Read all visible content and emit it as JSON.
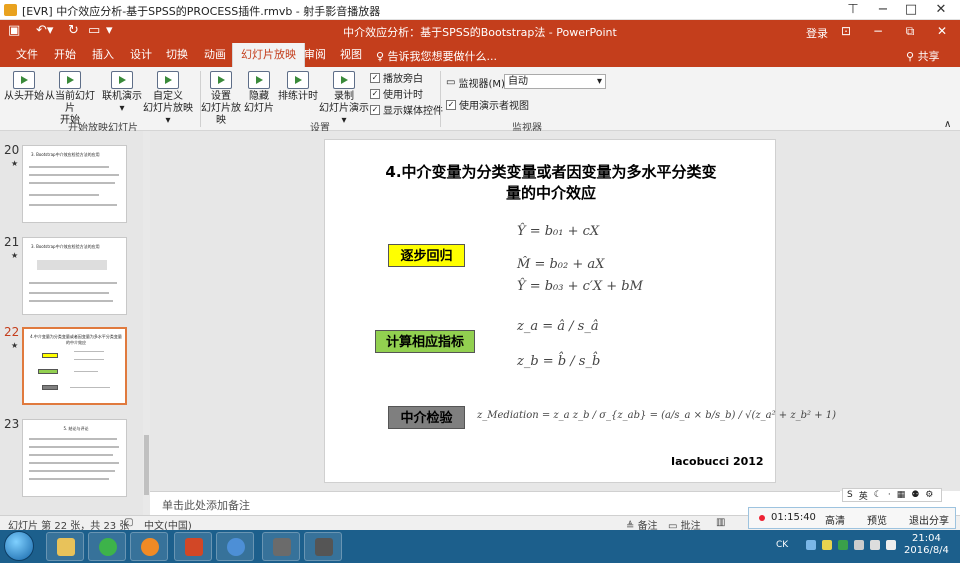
{
  "player": {
    "title": "[EVR] 中介效应分析-基于SPSS的PROCESS插件.rmvb - 射手影音播放器",
    "controls": {
      "pin": "⊤",
      "minimize": "−",
      "maximize": "□",
      "close": "✕"
    }
  },
  "ppt": {
    "window_title": "中介效应分析：基于SPSS的Bootstrap法 - PowerPoint",
    "login": "登录",
    "tabs": [
      "文件",
      "开始",
      "插入",
      "设计",
      "切换",
      "动画",
      "幻灯片放映",
      "审阅",
      "视图"
    ],
    "active_tab": "幻灯片放映",
    "tell_me": "♀ 告诉我您想要做什么...",
    "share": "共享"
  },
  "ribbon": {
    "start_group": {
      "label": "开始放映幻灯片",
      "buttons": [
        {
          "line1": "从头开始",
          "line2": ""
        },
        {
          "line1": "从当前幻灯片",
          "line2": "开始"
        },
        {
          "line1": "联机演示",
          "line2": "▾"
        },
        {
          "line1": "自定义",
          "line2": "幻灯片放映 ▾"
        }
      ]
    },
    "setup_group": {
      "label": "设置",
      "buttons": [
        {
          "line1": "设置",
          "line2": "幻灯片放映"
        },
        {
          "line1": "隐藏",
          "line2": "幻灯片"
        },
        {
          "line1": "排练计时",
          "line2": ""
        },
        {
          "line1": "录制",
          "line2": "幻灯片演示 ▾"
        }
      ],
      "checkboxes": [
        {
          "label": "播放旁白",
          "checked": true
        },
        {
          "label": "使用计时",
          "checked": true
        },
        {
          "label": "显示媒体控件",
          "checked": true
        }
      ]
    },
    "monitor_group": {
      "label": "监视器",
      "monitor_label": "监视器(M):",
      "monitor_value": "自动",
      "presenter_view": "使用演示者视图",
      "presenter_checked": true
    }
  },
  "thumbnails": [
    {
      "num": "20",
      "title": "3. Bootstrap中介效应检验方法的应用"
    },
    {
      "num": "21",
      "title": "3. Bootstrap中介效应检验方法的应用"
    },
    {
      "num": "22",
      "title": "4.中介变量为分类变量或者因变量为多水平分类变量的中介效应"
    },
    {
      "num": "23",
      "title": "5. 结论与评论"
    }
  ],
  "slide": {
    "title_line1": "4.中介变量为分类变量或者因变量为多水平分类变",
    "title_line2": "量的中介效应",
    "labels": [
      {
        "text": "逐步回归",
        "bg": "#ffff00"
      },
      {
        "text": "计算相应指标",
        "bg": "#92d050"
      },
      {
        "text": "中介检验",
        "bg": "#7f7f7f"
      }
    ],
    "equations": {
      "eq1": "Ŷ = b₀₁ + cX",
      "eq2": "M̂ = b₀₂ + aX",
      "eq3": "Ŷ = b₀₃ + c′X + bM",
      "eq4": "z_a = â / s_â",
      "eq5": "z_b = b̂ / s_b̂",
      "eq6": "z_Mediation = z_a z_b / σ_{z_ab} = (a/s_a × b/s_b) / √(z_a² + z_b² + 1)"
    },
    "credit": "Iacobucci 2012"
  },
  "notes_placeholder": "单击此处添加备注",
  "status": {
    "slide_info": "幻灯片 第 22 张，共 23 张",
    "language": "中文(中国)",
    "notes": "备注",
    "comments": "批注"
  },
  "recording": {
    "time": "01:15:40",
    "quality": "高清",
    "preview": "预览",
    "exit": "退出分享"
  },
  "taskbar": {
    "lang_indicator": "CK",
    "time": "21:04",
    "date": "2016/8/4"
  },
  "colors": {
    "ppt_accent": "#c43e1c",
    "taskbar": "#1c5f8c",
    "selected_thumb": "#e07a3e"
  }
}
